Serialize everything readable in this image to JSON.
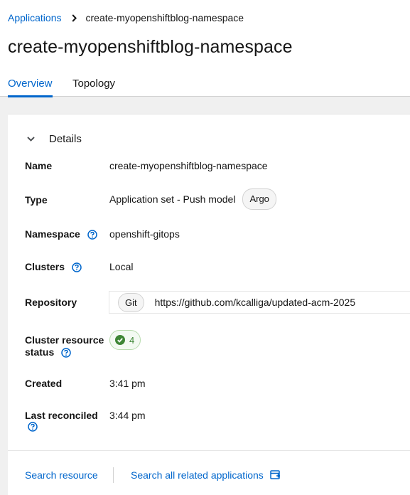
{
  "breadcrumb": {
    "parent": "Applications",
    "current": "create-myopenshiftblog-namespace"
  },
  "page": {
    "title": "create-myopenshiftblog-namespace"
  },
  "tabs": [
    {
      "label": "Overview",
      "active": true
    },
    {
      "label": "Topology",
      "active": false
    }
  ],
  "details": {
    "section_title": "Details",
    "name": {
      "label": "Name",
      "value": "create-myopenshiftblog-namespace"
    },
    "type": {
      "label": "Type",
      "value": "Application set - Push model",
      "badge": "Argo"
    },
    "namespace": {
      "label": "Namespace",
      "value": "openshift-gitops"
    },
    "clusters": {
      "label": "Clusters",
      "value": "Local"
    },
    "repository": {
      "label": "Repository",
      "badge": "Git",
      "url": "https://github.com/kcalliga/updated-acm-2025"
    },
    "cluster_resource_status": {
      "label_line1": "Cluster resource",
      "label_line2": "status",
      "count": "4"
    },
    "created": {
      "label": "Created",
      "value": "3:41 pm"
    },
    "last_reconciled": {
      "label": "Last reconciled",
      "value": "3:44 pm"
    }
  },
  "footer": {
    "search_resource": "Search resource",
    "search_related": "Search all related applications"
  },
  "colors": {
    "link": "#0066cc",
    "success": "#3e8635",
    "text": "#151515",
    "background": "#f0f0f0"
  },
  "icons": {
    "breadcrumb_separator": "chevron-right-icon",
    "toggle": "chevron-down-icon",
    "help": "question-circle-icon",
    "status_ok": "check-circle-icon",
    "external": "external-search-icon"
  }
}
